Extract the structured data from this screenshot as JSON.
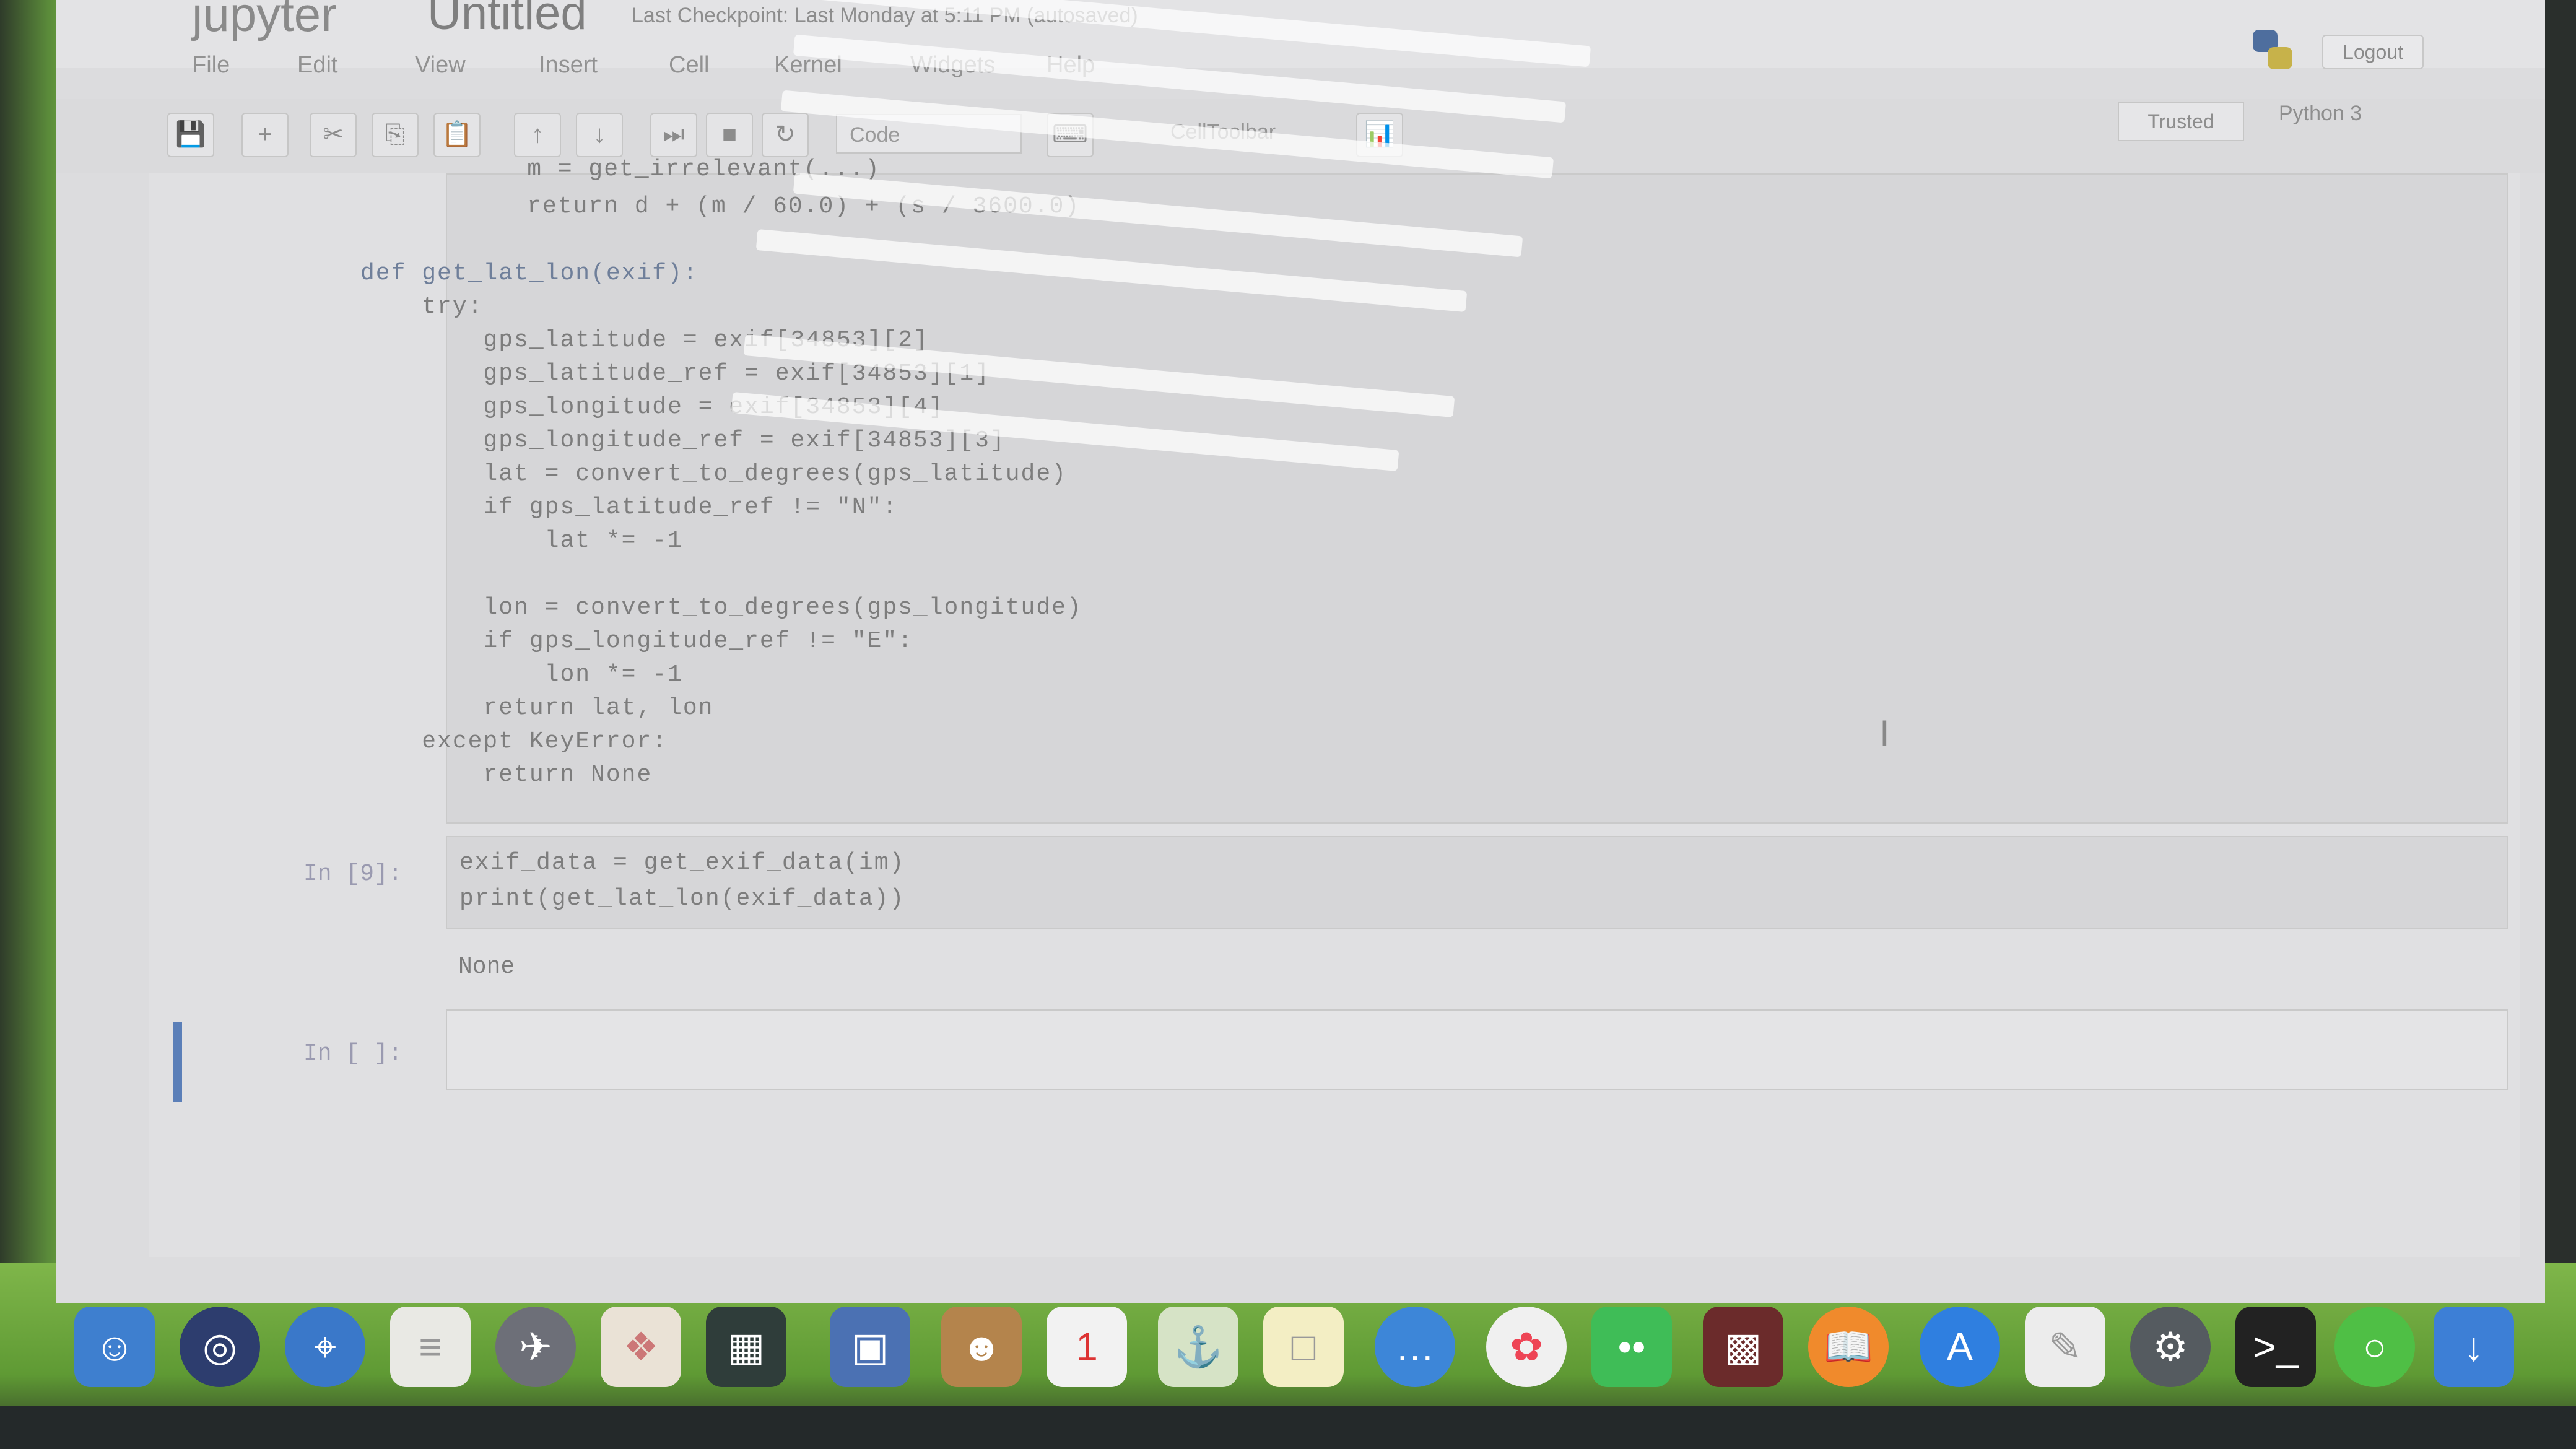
{
  "app": {
    "logo_text": "jupyter",
    "notebook_title": "Untitled",
    "checkpoint": "Last Checkpoint: Last Monday at 5:11 PM (autosaved)",
    "logout_label": "Logout"
  },
  "menu": [
    "File",
    "Edit",
    "View",
    "Insert",
    "Cell",
    "Kernel",
    "Widgets",
    "Help"
  ],
  "toolbar": {
    "buttons": [
      "save-icon",
      "add-icon",
      "cut-icon",
      "copy-icon",
      "paste-icon",
      "move-up-icon",
      "move-down-icon",
      "run-icon",
      "stop-icon",
      "restart-icon"
    ],
    "cell_type": "Code",
    "extra_label": "CellToolbar",
    "trusted_label": "Trusted",
    "kernel_label": "Python 3"
  },
  "cells": {
    "cell1_lines": [
      "    m = get_irrelevant(...)",
      "    return d + (m / 60.0) + (s / 3600.0)",
      "",
      "def get_lat_lon(exif):",
      "    try:",
      "        gps_latitude = exif[34853][2]",
      "        gps_latitude_ref = exif[34853][1]",
      "        gps_longitude = exif[34853][4]",
      "        gps_longitude_ref = exif[34853][3]",
      "        lat = convert_to_degrees(gps_latitude)",
      "        if gps_latitude_ref != \"N\":",
      "            lat *= -1",
      "",
      "        lon = convert_to_degrees(gps_longitude)",
      "        if gps_longitude_ref != \"E\":",
      "            lon *= -1",
      "        return lat, lon",
      "    except KeyError:",
      "        return None"
    ],
    "cell2_prompt": "In [9]:",
    "cell2_lines": [
      "exif_data = get_exif_data(im)",
      "print(get_lat_lon(exif_data))"
    ],
    "cell2_output": "None",
    "cell3_prompt": "In [ ]:"
  },
  "dock": [
    "finder-icon",
    "siri-icon",
    "safari-icon",
    "notes-icon",
    "launchpad-icon",
    "photos-preview-icon",
    "mission-control-icon",
    "image-capture-icon",
    "contacts-icon",
    "calendar-icon",
    "maps-icon",
    "stickies-icon",
    "messages-icon",
    "photos-icon",
    "wechat-icon",
    "photo-booth-icon",
    "books-icon",
    "app-store-icon",
    "textedit-icon",
    "system-preferences-icon",
    "terminal-icon",
    "spinner-icon",
    "downloads-icon"
  ]
}
